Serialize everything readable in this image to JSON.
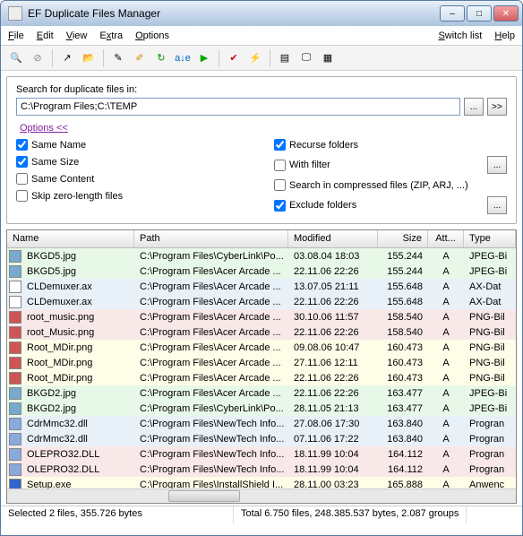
{
  "window": {
    "title": "EF Duplicate Files Manager"
  },
  "menu": {
    "file": "File",
    "edit": "Edit",
    "view": "View",
    "extra": "Extra",
    "options": "Options",
    "switch": "Switch list",
    "help": "Help"
  },
  "search": {
    "label": "Search for duplicate files in:",
    "path": "C:\\Program Files;C:\\TEMP",
    "optlink": "Options  <<",
    "sameName": "Same Name",
    "sameSize": "Same Size",
    "sameContent": "Same Content",
    "skipZero": "Skip zero-length files",
    "recurse": "Recurse folders",
    "withFilter": "With filter",
    "compressed": "Search in compressed files (ZIP, ARJ, ...)",
    "excludeFolders": "Exclude folders"
  },
  "cols": {
    "name": "Name",
    "path": "Path",
    "mod": "Modified",
    "size": "Size",
    "att": "Att...",
    "type": "Type"
  },
  "rows": [
    {
      "bg": "g",
      "ic": "#7ac",
      "n": "BKGD5.jpg",
      "p": "C:\\Program Files\\CyberLink\\Po...",
      "m": "03.08.04  18:03",
      "s": "155.244",
      "a": "A",
      "t": "JPEG-Bi"
    },
    {
      "bg": "g",
      "ic": "#7ac",
      "n": "BKGD5.jpg",
      "p": "C:\\Program Files\\Acer Arcade ...",
      "m": "22.11.06  22:26",
      "s": "155.244",
      "a": "A",
      "t": "JPEG-Bi"
    },
    {
      "bg": "b",
      "ic": "#fff",
      "n": "CLDemuxer.ax",
      "p": "C:\\Program Files\\Acer Arcade ...",
      "m": "13.07.05  21:11",
      "s": "155.648",
      "a": "A",
      "t": "AX-Dat"
    },
    {
      "bg": "b",
      "ic": "#fff",
      "n": "CLDemuxer.ax",
      "p": "C:\\Program Files\\Acer Arcade ...",
      "m": "22.11.06  22:26",
      "s": "155.648",
      "a": "A",
      "t": "AX-Dat"
    },
    {
      "bg": "p",
      "ic": "#c55",
      "n": "root_music.png",
      "p": "C:\\Program Files\\Acer Arcade ...",
      "m": "30.10.06  11:57",
      "s": "158.540",
      "a": "A",
      "t": "PNG-Bil"
    },
    {
      "bg": "p",
      "ic": "#c55",
      "n": "root_Music.png",
      "p": "C:\\Program Files\\Acer Arcade ...",
      "m": "22.11.06  22:26",
      "s": "158.540",
      "a": "A",
      "t": "PNG-Bil"
    },
    {
      "bg": "y",
      "ic": "#c55",
      "n": "Root_MDir.png",
      "p": "C:\\Program Files\\Acer Arcade ...",
      "m": "09.08.06  10:47",
      "s": "160.473",
      "a": "A",
      "t": "PNG-Bil"
    },
    {
      "bg": "y",
      "ic": "#c55",
      "n": "Root_MDir.png",
      "p": "C:\\Program Files\\Acer Arcade ...",
      "m": "27.11.06  12:11",
      "s": "160.473",
      "a": "A",
      "t": "PNG-Bil"
    },
    {
      "bg": "y",
      "ic": "#c55",
      "n": "Root_MDir.png",
      "p": "C:\\Program Files\\Acer Arcade ...",
      "m": "22.11.06  22:26",
      "s": "160.473",
      "a": "A",
      "t": "PNG-Bil"
    },
    {
      "bg": "g",
      "ic": "#7ac",
      "n": "BKGD2.jpg",
      "p": "C:\\Program Files\\Acer Arcade ...",
      "m": "22.11.06  22:26",
      "s": "163.477",
      "a": "A",
      "t": "JPEG-Bi"
    },
    {
      "bg": "g",
      "ic": "#7ac",
      "n": "BKGD2.jpg",
      "p": "C:\\Program Files\\CyberLink\\Po...",
      "m": "28.11.05  21:13",
      "s": "163.477",
      "a": "A",
      "t": "JPEG-Bi"
    },
    {
      "bg": "b",
      "ic": "#8ad",
      "n": "CdrMmc32.dll",
      "p": "C:\\Program Files\\NewTech Info...",
      "m": "27.08.06  17:30",
      "s": "163.840",
      "a": "A",
      "t": "Progran"
    },
    {
      "bg": "b",
      "ic": "#8ad",
      "n": "CdrMmc32.dll",
      "p": "C:\\Program Files\\NewTech Info...",
      "m": "07.11.06  17:22",
      "s": "163.840",
      "a": "A",
      "t": "Progran"
    },
    {
      "bg": "p",
      "ic": "#8ad",
      "n": "OLEPRO32.DLL",
      "p": "C:\\Program Files\\NewTech Info...",
      "m": "18.11.99  10:04",
      "s": "164.112",
      "a": "A",
      "t": "Progran"
    },
    {
      "bg": "p",
      "ic": "#8ad",
      "n": "OLEPRO32.DLL",
      "p": "C:\\Program Files\\NewTech Info...",
      "m": "18.11.99  10:04",
      "s": "164.112",
      "a": "A",
      "t": "Progran"
    },
    {
      "bg": "y",
      "ic": "#36c",
      "n": "Setup.exe",
      "p": "C:\\Program Files\\InstallShield I...",
      "m": "28.11.00  03:23",
      "s": "165.888",
      "a": "A",
      "t": "Anwenc"
    }
  ],
  "status": {
    "left": "Selected 2 files, 355.726 bytes",
    "right": "Total 6.750 files, 248.385.537 bytes, 2.087 groups"
  }
}
